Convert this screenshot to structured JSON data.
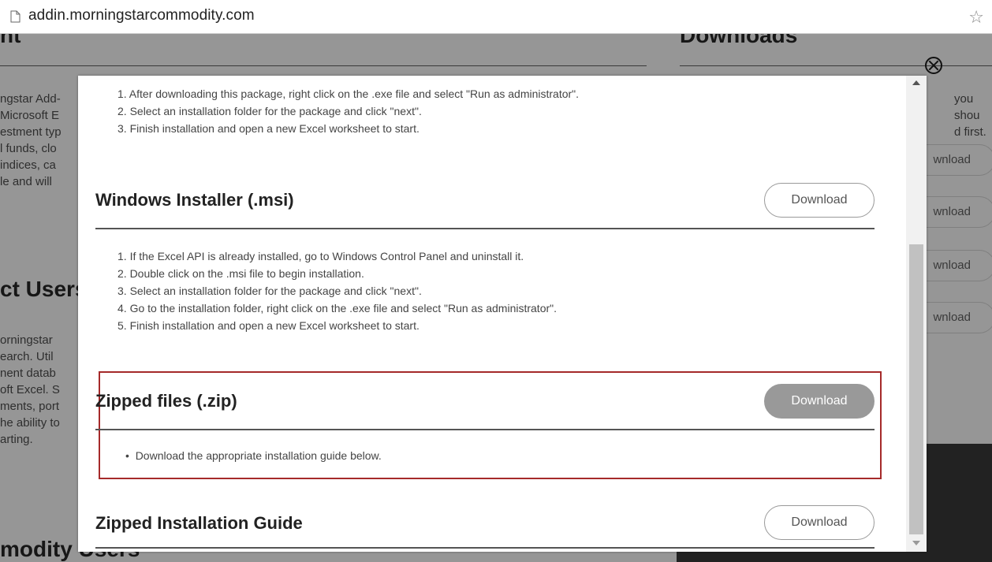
{
  "browser": {
    "url": "addin.morningstarcommodity.com"
  },
  "background": {
    "heading_partial_top": "nt",
    "downloads_heading": "Downloads",
    "left_lines": [
      "ngstar Add-",
      "Microsoft E",
      "estment typ",
      "l funds, clo",
      "indices, ca",
      "le and will"
    ],
    "right_lines": [
      "you shou",
      "d first."
    ],
    "section_heading": "ct Users",
    "left_lines_2": [
      "orningstar",
      "earch. Util",
      "nent datab",
      "oft Excel. S",
      "ments, port",
      "he ability to",
      "arting."
    ],
    "bottom_heading": "modity Users",
    "download_partial": "wnload"
  },
  "modal": {
    "exe_steps": [
      "1.  After downloading this package, right click on the .exe file and select \"Run as administrator\".",
      "2.  Select an installation folder for the package and click \"next\".",
      "3.  Finish installation and open a new Excel worksheet to start."
    ],
    "msi": {
      "title": "Windows Installer (.msi)",
      "button": "Download",
      "steps": [
        "1.  If the Excel API is already installed, go to Windows Control Panel and uninstall it.",
        "2.  Double click on the .msi file to begin installation.",
        "3.  Select an installation folder for the package and click \"next\".",
        "4.  Go to the installation folder, right click on the .exe file and select \"Run as administrator\".",
        "5.  Finish installation and open a new Excel worksheet to start."
      ]
    },
    "zip": {
      "title": "Zipped files (.zip)",
      "button": "Download",
      "bullet": "Download the appropriate installation guide below."
    },
    "guide": {
      "title": "Zipped Installation Guide",
      "button": "Download"
    }
  },
  "colors": {
    "highlight": "#a52a2a",
    "active_button": "#999999"
  }
}
